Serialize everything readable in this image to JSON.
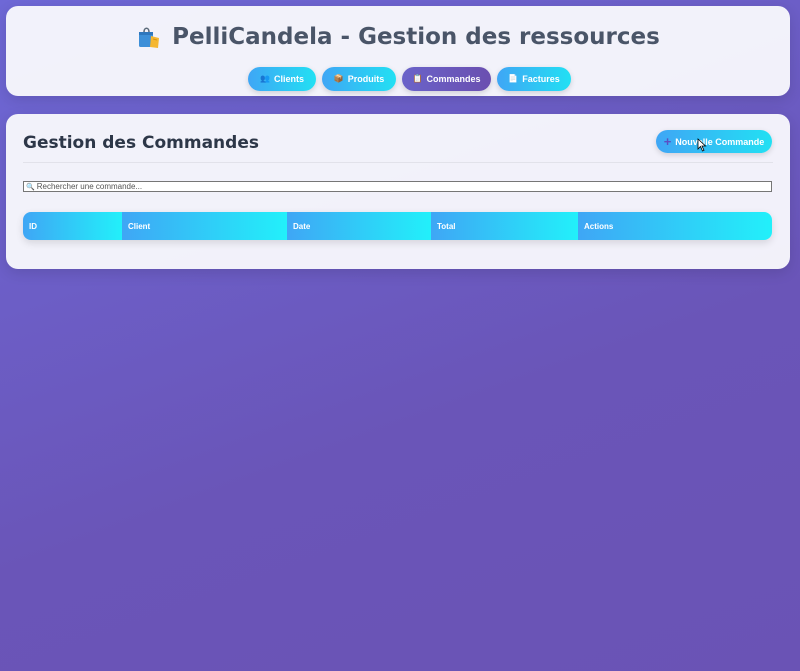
{
  "header": {
    "app_icon": "shopping-bag-icon",
    "title": "PelliCandela - Gestion des ressources"
  },
  "nav": {
    "items": [
      {
        "icon": "people-icon",
        "icon_glyph": "👥",
        "label": "Clients"
      },
      {
        "icon": "box-icon",
        "icon_glyph": "📦",
        "label": "Produits"
      },
      {
        "icon": "clipboard-icon",
        "icon_glyph": "📋",
        "label": "Commandes",
        "active": true
      },
      {
        "icon": "document-icon",
        "icon_glyph": "📄",
        "label": "Factures"
      }
    ]
  },
  "main": {
    "title": "Gestion des Commandes",
    "new_button": {
      "icon": "plus-icon",
      "icon_glyph": "+",
      "label": "Nouvelle Commande"
    },
    "search": {
      "icon": "search-icon",
      "icon_glyph": "🔍",
      "value": "",
      "placeholder": "Rechercher une commande..."
    },
    "table": {
      "columns": [
        "ID",
        "Client",
        "Date",
        "Total",
        "Actions"
      ],
      "rows": []
    }
  },
  "colors": {
    "accent_gradient_start": "#3fa6f5",
    "accent_gradient_end": "#22e0f3",
    "active_tab": "#6a5acd",
    "background": "#6a5ac4"
  }
}
